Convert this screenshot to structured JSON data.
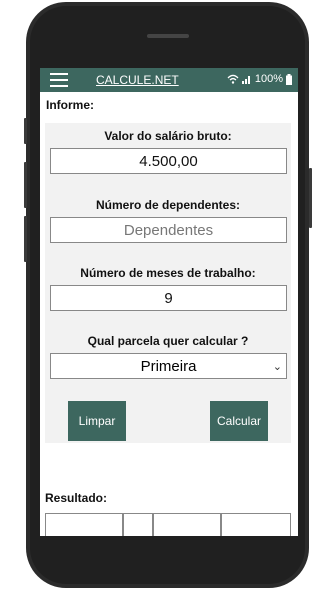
{
  "appbar": {
    "title": "CALCULE.NET",
    "battery": "100%",
    "accent": "#3d675f"
  },
  "form": {
    "header": "Informe:",
    "salary_label": "Valor do salário bruto:",
    "salary_value": "4.500,00",
    "dependents_label": "Número de dependentes:",
    "dependents_placeholder": "Dependentes",
    "months_label": "Número de meses de trabalho:",
    "months_value": "9",
    "installment_label": "Qual parcela quer calcular ?",
    "installment_selected": "Primeira",
    "clear_label": "Limpar",
    "calculate_label": "Calcular"
  },
  "result": {
    "label": "Resultado:"
  }
}
